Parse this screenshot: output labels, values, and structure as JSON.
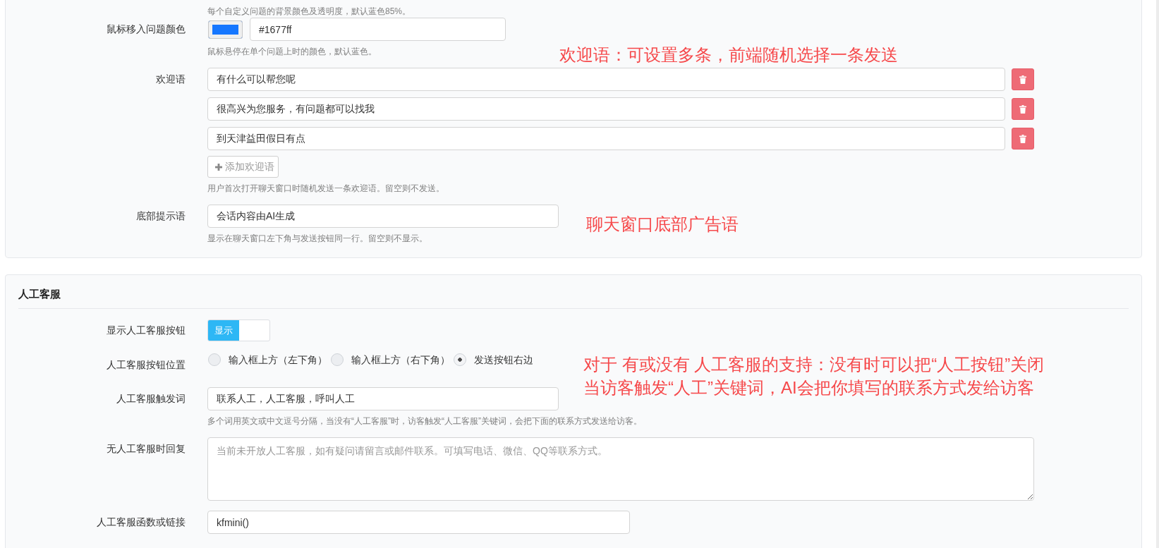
{
  "general_card": {
    "top_help": "每个自定义问题的背景颜色及透明度，默认蓝色85%。",
    "fields": [
      {
        "kind": "color",
        "label": "鼠标移入问题颜色",
        "color": "#1677ff",
        "value": "#1677ff",
        "help": "鼠标悬停在单个问题上时的颜色，默认蓝色。"
      },
      {
        "kind": "list",
        "label": "欢迎语",
        "items": [
          "有什么可以帮您呢",
          "很高兴为您服务，有问题都可以找我",
          "到天津益田假日有点"
        ],
        "add_button": "添加欢迎语",
        "help": "用户首次打开聊天窗口时随机发送一条欢迎语。留空则不发送。"
      },
      {
        "kind": "text",
        "label": "底部提示语",
        "value": "会话内容由AI生成",
        "help": "显示在聊天窗口左下角与发送按钮同一行。留空则不显示。"
      }
    ]
  },
  "manual_service_card": {
    "title": "人工客服",
    "fields": [
      {
        "kind": "toggle",
        "label": "显示人工客服按钮",
        "on": true,
        "on_label": "显示"
      },
      {
        "kind": "radio",
        "label": "人工客服按钮位置",
        "options": [
          {
            "label": "输入框上方（左下角）",
            "selected": false
          },
          {
            "label": "输入框上方（右下角）",
            "selected": false
          },
          {
            "label": "发送按钮右边",
            "selected": true
          }
        ]
      },
      {
        "kind": "text",
        "label": "人工客服触发词",
        "value": "联系人工，人工客服，呼叫人工",
        "help": "多个词用英文或中文逗号分隔，当没有“人工客服”时，访客触发“人工客服”关键词，会把下面的联系方式发送给访客。"
      },
      {
        "kind": "textarea",
        "label": "无人工客服时回复",
        "placeholder": "当前未开放人工客服，如有疑问请留言或邮件联系。可填写电话、微信、QQ等联系方式。"
      },
      {
        "kind": "text",
        "label": "人工客服函数或链接",
        "value": "kfmini()"
      }
    ]
  },
  "annotations": [
    {
      "lines": [
        "欢迎语：可设置多条，前端随机选择一条发送"
      ]
    },
    {
      "lines": [
        "聊天窗口底部广告语"
      ]
    },
    {
      "lines": [
        "对于 有或没有 人工客服的支持：没有时可以把“人工按钮”关闭",
        "当访客触发“人工”关键词，AI会把你填写的联系方式发给访客"
      ]
    }
  ]
}
